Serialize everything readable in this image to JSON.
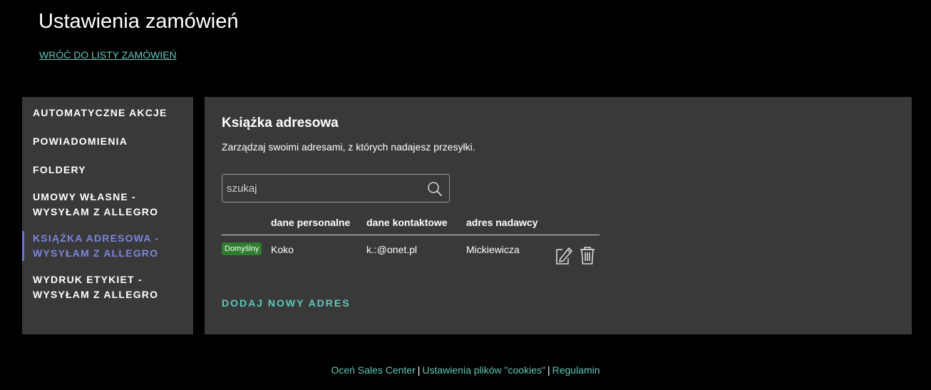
{
  "header": {
    "title": "Ustawienia zamówień",
    "back_link": "WRÓĆ DO LISTY ZAMÓWIEŃ"
  },
  "sidebar": {
    "items": [
      {
        "line1": "AUTOMATYCZNE AKCJE",
        "line2": ""
      },
      {
        "line1": "POWIADOMIENIA",
        "line2": ""
      },
      {
        "line1": "FOLDERY",
        "line2": ""
      },
      {
        "line1": "UMOWY WŁASNE -",
        "line2": "WYSYŁAM Z ALLEGRO"
      },
      {
        "line1": "KSIĄŻKA ADRESOWA -",
        "line2": "WYSYŁAM Z ALLEGRO"
      },
      {
        "line1": "WYDRUK ETYKIET -",
        "line2": "WYSYŁAM Z ALLEGRO"
      }
    ],
    "active_index": 4
  },
  "main": {
    "title": "Książka adresowa",
    "description": "Zarządzaj swoimi adresami, z których nadajesz przesyłki.",
    "search": {
      "placeholder": "szukaj",
      "value": "",
      "icon": "search-icon"
    },
    "table": {
      "columns": [
        "dane personalne",
        "dane kontaktowe",
        "adres nadawcy"
      ],
      "rows": [
        {
          "badge": "Domyślny",
          "personal": "Koko",
          "contact": "k.:@onet.pl",
          "address": "Mickiewicza",
          "actions": [
            "edit-icon",
            "trash-icon"
          ]
        }
      ]
    },
    "add_button": "DODAJ NOWY ADRES"
  },
  "footer": {
    "links": [
      "Oceń Sales Center",
      "Ustawienia plików \"cookies\"",
      "Regulamin"
    ],
    "separator": "|"
  },
  "colors": {
    "background": "#000000",
    "panel": "#393939",
    "accent_teal": "#5fc9b9",
    "active_item": "#7b86e0",
    "badge_green": "#2f7d2f"
  }
}
